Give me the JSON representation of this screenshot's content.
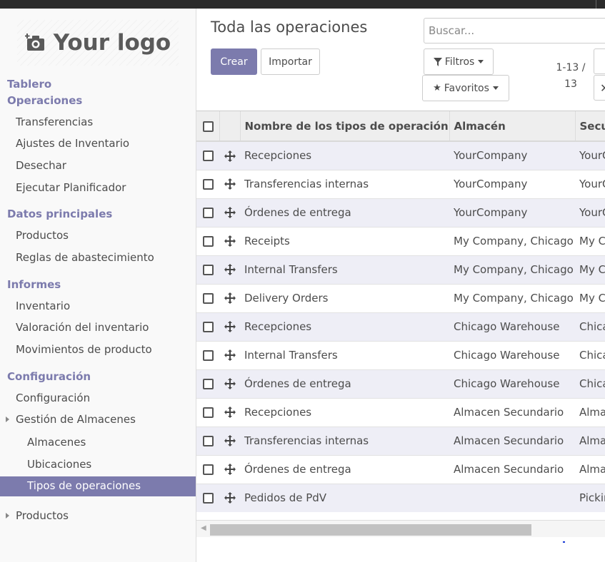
{
  "logo": {
    "text": "Your logo"
  },
  "sidebar": {
    "sections": [
      {
        "header": "Tablero",
        "items": []
      },
      {
        "header": "Operaciones",
        "items": [
          "Transferencias",
          "Ajustes de Inventario",
          "Desechar",
          "Ejecutar Planificador"
        ]
      },
      {
        "header": "Datos principales",
        "items": [
          "Productos",
          "Reglas de abastecimiento"
        ]
      },
      {
        "header": "Informes",
        "items": [
          "Inventario",
          "Valoración del inventario",
          "Movimientos de producto"
        ]
      },
      {
        "header": "Configuración",
        "items": [
          "Configuración",
          "Gestión de Almacenes",
          "Almacenes",
          "Ubicaciones",
          "Tipos de operaciones",
          "Productos"
        ]
      }
    ]
  },
  "main": {
    "title": "Toda las operaciones",
    "search_placeholder": "Buscar...",
    "create_label": "Crear",
    "import_label": "Importar",
    "filters_label": "Filtros",
    "favorites_label": "Favoritos",
    "pager_text": "1-13 / 13",
    "pager_line1": "1-13 /",
    "pager_line2": "13"
  },
  "table": {
    "columns": [
      "Nombre de los tipos de operación",
      "Almacén",
      "Secu"
    ],
    "rows": [
      [
        "Recepciones",
        "YourCompany",
        "YourC"
      ],
      [
        "Transferencias internas",
        "YourCompany",
        "YourC"
      ],
      [
        "Órdenes de entrega",
        "YourCompany",
        "YourC"
      ],
      [
        "Receipts",
        "My Company, Chicago",
        "My C"
      ],
      [
        "Internal Transfers",
        "My Company, Chicago",
        "My C"
      ],
      [
        "Delivery Orders",
        "My Company, Chicago",
        "My C"
      ],
      [
        "Recepciones",
        "Chicago Warehouse",
        "Chica"
      ],
      [
        "Internal Transfers",
        "Chicago Warehouse",
        "Chica"
      ],
      [
        "Órdenes de entrega",
        "Chicago Warehouse",
        "Chica"
      ],
      [
        "Recepciones",
        "Almacen Secundario",
        "Alma"
      ],
      [
        "Transferencias internas",
        "Almacen Secundario",
        "Alma"
      ],
      [
        "Órdenes de entrega",
        "Almacen Secundario",
        "Alma"
      ],
      [
        "Pedidos de PdV",
        "",
        "Pickin"
      ]
    ]
  },
  "colors": {
    "accent": "#7c7bad",
    "row_alt": "#eeeef6"
  }
}
